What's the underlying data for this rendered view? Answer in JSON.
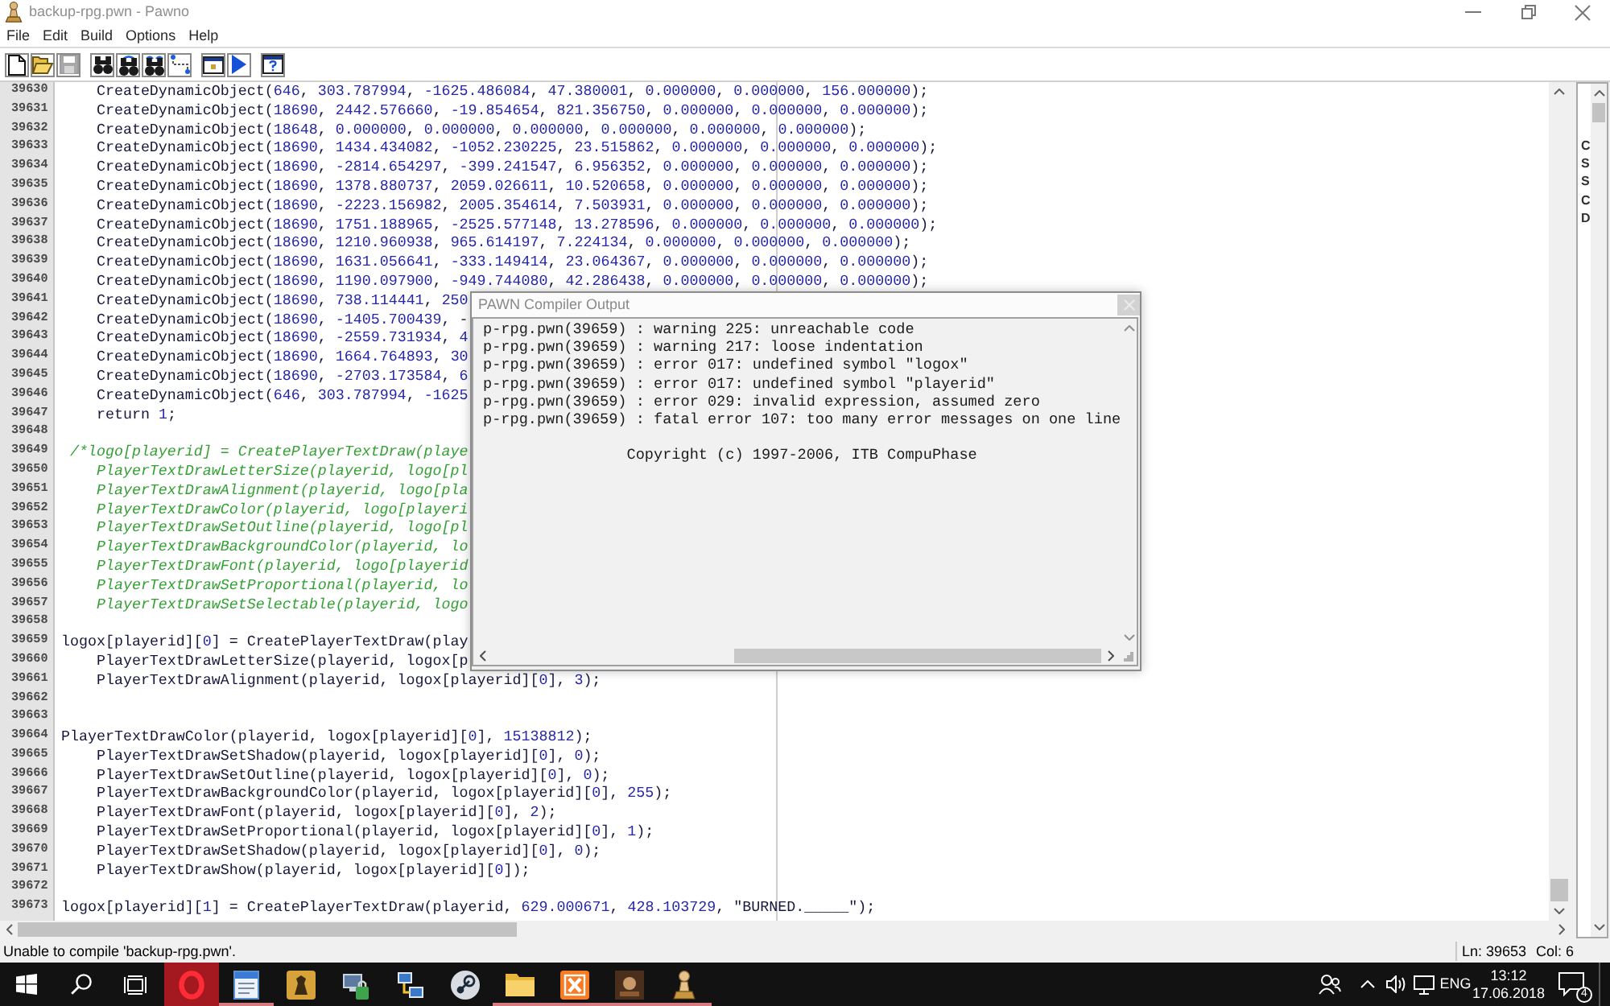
{
  "window": {
    "title": "backup-rpg.pwn - Pawno"
  },
  "menu": [
    "File",
    "Edit",
    "Build",
    "Options",
    "Help"
  ],
  "toolbar": {
    "groups": [
      [
        {
          "kind": "new",
          "disabled": false
        },
        {
          "kind": "open",
          "disabled": false
        },
        {
          "kind": "save",
          "disabled": true
        }
      ],
      [
        {
          "kind": "find",
          "disabled": false
        },
        {
          "kind": "find-next",
          "disabled": false
        },
        {
          "kind": "replace",
          "disabled": false
        },
        {
          "kind": "goto",
          "disabled": false
        }
      ],
      [
        {
          "kind": "output",
          "disabled": false
        },
        {
          "kind": "compile",
          "disabled": false
        }
      ],
      [
        {
          "kind": "help",
          "disabled": false
        }
      ]
    ]
  },
  "editor": {
    "lines": [
      {
        "number": "39630",
        "kind": "code",
        "text": "    CreateDynamicObject(646, 303.787994, -1625.486084, 47.380001, 0.000000, 0.000000, 156.000000);"
      },
      {
        "number": "39631",
        "kind": "code",
        "text": "    CreateDynamicObject(18690, 2442.576660, -19.854654, 821.356750, 0.000000, 0.000000, 0.000000);"
      },
      {
        "number": "39632",
        "kind": "code",
        "text": "    CreateDynamicObject(18648, 0.000000, 0.000000, 0.000000, 0.000000, 0.000000, 0.000000);"
      },
      {
        "number": "39633",
        "kind": "code",
        "text": "    CreateDynamicObject(18690, 1434.434082, -1052.230225, 23.515862, 0.000000, 0.000000, 0.000000);"
      },
      {
        "number": "39634",
        "kind": "code",
        "text": "    CreateDynamicObject(18690, -2814.654297, -399.241547, 6.956352, 0.000000, 0.000000, 0.000000);"
      },
      {
        "number": "39635",
        "kind": "code",
        "text": "    CreateDynamicObject(18690, 1378.880737, 2059.026611, 10.520658, 0.000000, 0.000000, 0.000000);"
      },
      {
        "number": "39636",
        "kind": "code",
        "text": "    CreateDynamicObject(18690, -2223.156982, 2005.354614, 7.503931, 0.000000, 0.000000, 0.000000);"
      },
      {
        "number": "39637",
        "kind": "code",
        "text": "    CreateDynamicObject(18690, 1751.188965, -2525.577148, 13.278596, 0.000000, 0.000000, 0.000000);"
      },
      {
        "number": "39638",
        "kind": "code",
        "text": "    CreateDynamicObject(18690, 1210.960938, 965.614197, 7.224134, 0.000000, 0.000000, 0.000000);"
      },
      {
        "number": "39639",
        "kind": "code",
        "text": "    CreateDynamicObject(18690, 1631.056641, -333.149414, 23.064367, 0.000000, 0.000000, 0.000000);"
      },
      {
        "number": "39640",
        "kind": "code",
        "text": "    CreateDynamicObject(18690, 1190.097900, -949.744080, 42.286438, 0.000000, 0.000000, 0.000000);"
      },
      {
        "number": "39641",
        "kind": "code",
        "text": "    CreateDynamicObject(18690, 738.114441, 250"
      },
      {
        "number": "39642",
        "kind": "code",
        "text": "    CreateDynamicObject(18690, -1405.700439, -"
      },
      {
        "number": "39643",
        "kind": "code",
        "text": "    CreateDynamicObject(18690, -2559.731934, 4"
      },
      {
        "number": "39644",
        "kind": "code",
        "text": "    CreateDynamicObject(18690, 1664.764893, 30"
      },
      {
        "number": "39645",
        "kind": "code",
        "text": "    CreateDynamicObject(18690, -2703.173584, 6"
      },
      {
        "number": "39646",
        "kind": "code",
        "text": "    CreateDynamicObject(646, 303.787994, -1625"
      },
      {
        "number": "39647",
        "kind": "code",
        "text": "    return 1;"
      },
      {
        "number": "39648"
      },
      {
        "number": "39649",
        "kind": "comment",
        "text": " /*logo[playerid] = CreatePlayerTextDraw(playe"
      },
      {
        "number": "39650",
        "kind": "comment",
        "text": "    PlayerTextDrawLetterSize(playerid, logo[pl"
      },
      {
        "number": "39651",
        "kind": "comment",
        "text": "    PlayerTextDrawAlignment(playerid, logo[pla"
      },
      {
        "number": "39652",
        "kind": "comment",
        "text": "    PlayerTextDrawColor(playerid, logo[playeri"
      },
      {
        "number": "39653",
        "kind": "comment",
        "text": "    PlayerTextDrawSetOutline(playerid, logo[pl"
      },
      {
        "number": "39654",
        "kind": "comment",
        "text": "    PlayerTextDrawBackgroundColor(playerid, lo"
      },
      {
        "number": "39655",
        "kind": "comment",
        "text": "    PlayerTextDrawFont(playerid, logo[playerid"
      },
      {
        "number": "39656",
        "kind": "comment",
        "text": "    PlayerTextDrawSetProportional(playerid, lo"
      },
      {
        "number": "39657",
        "kind": "comment",
        "text": "    PlayerTextDrawSetSelectable(playerid, logo"
      },
      {
        "number": "39658"
      },
      {
        "number": "39659",
        "kind": "code",
        "text": "logox[playerid][0] = CreatePlayerTextDraw(play"
      },
      {
        "number": "39660",
        "kind": "code",
        "text": "    PlayerTextDrawLetterSize(playerid, logox[p"
      },
      {
        "number": "39661",
        "kind": "code",
        "text": "    PlayerTextDrawAlignment(playerid, logox[playerid][0], 3);"
      },
      {
        "number": "39662"
      },
      {
        "number": "39663"
      },
      {
        "number": "39664",
        "kind": "code",
        "text": "PlayerTextDrawColor(playerid, logox[playerid][0], 15138812);"
      },
      {
        "number": "39665",
        "kind": "code",
        "text": "    PlayerTextDrawSetShadow(playerid, logox[playerid][0], 0);"
      },
      {
        "number": "39666",
        "kind": "code",
        "text": "    PlayerTextDrawSetOutline(playerid, logox[playerid][0], 0);"
      },
      {
        "number": "39667",
        "kind": "code",
        "text": "    PlayerTextDrawBackgroundColor(playerid, logox[playerid][0], 255);"
      },
      {
        "number": "39668",
        "kind": "code",
        "text": "    PlayerTextDrawFont(playerid, logox[playerid][0], 2);"
      },
      {
        "number": "39669",
        "kind": "code",
        "text": "    PlayerTextDrawSetProportional(playerid, logox[playerid][0], 1);"
      },
      {
        "number": "39670",
        "kind": "code",
        "text": "    PlayerTextDrawSetShadow(playerid, logox[playerid][0], 0);"
      },
      {
        "number": "39671",
        "kind": "code",
        "text": "    PlayerTextDrawShow(playerid, logox[playerid][0]);"
      },
      {
        "number": "39672"
      },
      {
        "number": "39673",
        "kind": "code",
        "text": "logox[playerid][1] = CreatePlayerTextDraw(playerid, 629.000671, 428.103729, \"BURNED._____\");"
      }
    ]
  },
  "function_list": {
    "items": [
      "C",
      "S",
      "S",
      "C",
      "D"
    ]
  },
  "compiler_output": {
    "title": "PAWN Compiler Output",
    "messages": [
      "p-rpg.pwn(39659) : warning 225: unreachable code",
      "p-rpg.pwn(39659) : warning 217: loose indentation",
      "p-rpg.pwn(39659) : error 017: undefined symbol \"logox\"",
      "p-rpg.pwn(39659) : error 017: undefined symbol \"playerid\"",
      "p-rpg.pwn(39659) : error 029: invalid expression, assumed zero",
      "p-rpg.pwn(39659) : fatal error 107: too many error messages on one line"
    ],
    "copyright": "Copyright (c) 1997-2006, ITB CompuPhase"
  },
  "status_bar": {
    "message": "Unable to compile 'backup-rpg.pwn'.",
    "line": "Ln: 39653",
    "column": "Col: 6"
  },
  "taskbar": {
    "apps": [
      {
        "kind": "browser",
        "highlighted": true,
        "running": false
      },
      {
        "kind": "notes",
        "highlighted": false,
        "running": true
      },
      {
        "kind": "game",
        "highlighted": false,
        "running": false
      },
      {
        "kind": "lock",
        "highlighted": false,
        "running": false
      },
      {
        "kind": "network",
        "highlighted": false,
        "running": false
      },
      {
        "kind": "disc",
        "highlighted": false,
        "running": false
      },
      {
        "kind": "folder",
        "highlighted": false,
        "running": true
      },
      {
        "kind": "server",
        "highlighted": false,
        "running": true
      },
      {
        "kind": "picture",
        "highlighted": false,
        "running": true
      },
      {
        "kind": "pawn",
        "highlighted": false,
        "running": true
      }
    ],
    "tray": {
      "language": "ENG",
      "time": "13:12",
      "date": "17.06.2018",
      "notifications": "4"
    }
  }
}
